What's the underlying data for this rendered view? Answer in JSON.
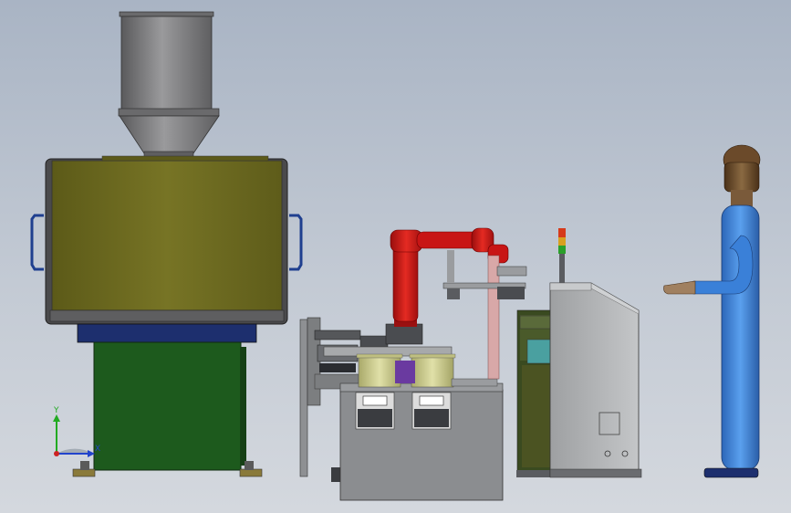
{
  "viewport": {
    "background_top": "#a9b4c4",
    "background_bottom": "#d4d8de"
  },
  "components": {
    "hopper": {
      "color": "#7e7e80"
    },
    "main_bin": {
      "color": "#6e6b1e",
      "frame_color": "#4a4a4c",
      "handle_color": "#2a4a9a"
    },
    "stand": {
      "color": "#1d5a1d",
      "plate_color": "#1d2f6e",
      "foot_color": "#8a7a3a"
    },
    "robot_arm": {
      "color": "#c81515"
    },
    "feeder_bowls": {
      "color": "#c9c98a"
    },
    "signal_tower": {
      "colors": [
        "#d63a1a",
        "#d8a020",
        "#2aa02a"
      ]
    },
    "cabinet": {
      "color": "#b5b7b9"
    },
    "operator_figure": {
      "body_color": "#3a7fd5",
      "head_color": "#6b4a2a",
      "hand_color": "#a08060"
    }
  },
  "triad": {
    "y_label": "Y",
    "x_label": "X",
    "y_color": "#22aa22",
    "x_color": "#2244cc",
    "origin_color": "#cc2222"
  }
}
